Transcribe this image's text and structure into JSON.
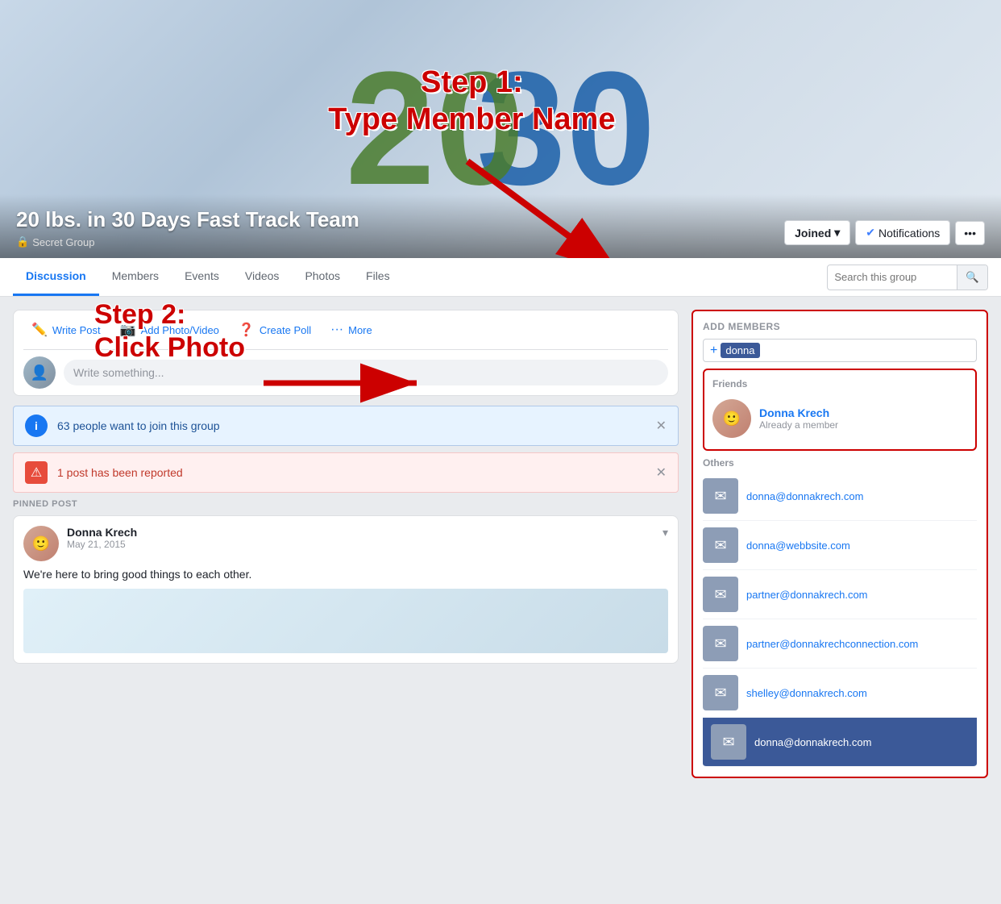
{
  "cover": {
    "logo_left": "20",
    "logo_right": "30",
    "group_name": "20 lbs. in 30 Days Fast Track Team",
    "group_type": "Secret Group",
    "lock_icon": "🔒",
    "btn_joined": "Joined",
    "btn_notifications": "Notifications",
    "btn_more": "•••",
    "checkmark": "✔"
  },
  "step1": {
    "line1": "Step 1:",
    "line2": "Type Member Name"
  },
  "step2": {
    "line1": "Step 2:",
    "line2": "Click Photo"
  },
  "nav": {
    "tabs": [
      {
        "label": "Discussion",
        "active": true
      },
      {
        "label": "Members",
        "active": false
      },
      {
        "label": "Events",
        "active": false
      },
      {
        "label": "Videos",
        "active": false
      },
      {
        "label": "Photos",
        "active": false
      },
      {
        "label": "Files",
        "active": false
      }
    ],
    "search_placeholder": "Search this group",
    "search_icon": "🔍"
  },
  "composer": {
    "write_post": "Write Post",
    "add_photo": "Add Photo/Video",
    "create_poll": "Create Poll",
    "more": "More",
    "write_placeholder": "Write something..."
  },
  "notifications": [
    {
      "type": "blue",
      "text": "63 people want to join this group",
      "icon": "i"
    },
    {
      "type": "red",
      "text": "1 post has been reported",
      "icon": "⚠"
    }
  ],
  "pinned_post": {
    "label": "PINNED POST",
    "author": "Donna Krech",
    "date": "May 21, 2015",
    "text": "We're here to bring good things to each other."
  },
  "right_panel": {
    "add_members_title": "ADD MEMBERS",
    "add_plus": "+",
    "typed_value": "donna",
    "friends_label": "Friends",
    "friends": [
      {
        "name": "Donna Krech",
        "sub": "Already a member"
      }
    ],
    "others_label": "Others",
    "others": [
      {
        "email": "donna@donnakrech.com"
      },
      {
        "email": "donna@webbsite.com"
      },
      {
        "email": "partner@donnakrech.com"
      },
      {
        "email": "partner@donnakrechconnection.com"
      },
      {
        "email": "shelley@donnakrech.com"
      },
      {
        "email": "donna@donnakrech.com"
      }
    ]
  }
}
